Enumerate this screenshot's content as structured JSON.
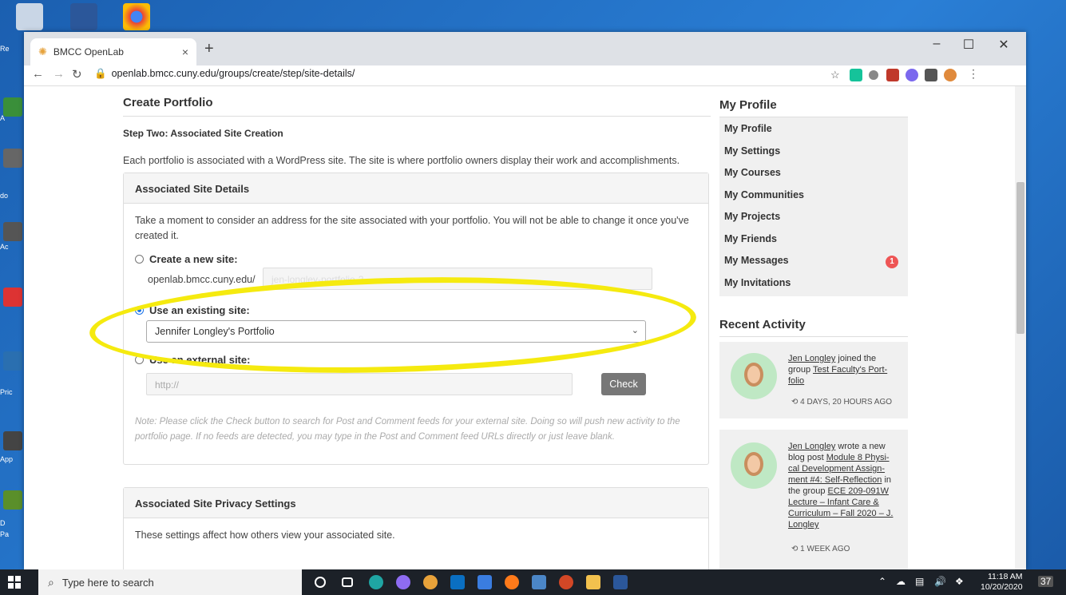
{
  "browser": {
    "tab_title": "BMCC OpenLab",
    "tab_close": "×",
    "new_tab": "+",
    "url": "openlab.bmcc.cuny.edu/groups/create/step/site-details/",
    "controls": {
      "minimize": "–",
      "maximize": "☐",
      "close": "✕"
    }
  },
  "desktop_labels": [
    "Re",
    "A",
    "do",
    "Ac",
    "Pric",
    "App",
    "D",
    "Pa"
  ],
  "page": {
    "title": "Create Portfolio",
    "step": "Step Two: Associated Site Creation",
    "description": "Each portfolio is associated with a WordPress site. The site is where portfolio owners display their work and accomplishments.",
    "details_panel": {
      "heading": "Associated Site Details",
      "intro": "Take a moment to consider an address for the site associated with your portfolio. You will not be able to change it once you've created it.",
      "option_new": "Create a new site:",
      "new_prefix": "openlab.bmcc.cuny.edu/",
      "new_value": "jen-longley-portfolio-2",
      "option_existing": "Use an existing site:",
      "existing_selected": "Jennifer Longley's Portfolio",
      "option_external": "Use an external site:",
      "external_placeholder": "http://",
      "check_button": "Check",
      "note": "Note: Please click the Check button to search for Post and Comment feeds for your external site. Doing so will push new activity to the portfolio page. If no feeds are detected, you may type in the Post and Comment feed URLs directly or just leave blank."
    },
    "privacy_panel": {
      "heading": "Associated Site Privacy Settings",
      "text": "These settings affect how others view your associated site."
    }
  },
  "sidebar": {
    "profile_title": "My Profile",
    "menu": [
      {
        "label": "My Profile"
      },
      {
        "label": "My Settings"
      },
      {
        "label": "My Courses"
      },
      {
        "label": "My Communities"
      },
      {
        "label": "My Projects"
      },
      {
        "label": "My Friends"
      },
      {
        "label": "My Messages",
        "badge": "1"
      },
      {
        "label": "My Invitations"
      }
    ],
    "activity_title": "Recent Activity",
    "activities": [
      {
        "user": "Jen Longley",
        "action": " joined the group ",
        "target": "Test Faculty's Port-folio",
        "time": "4 DAYS, 20 HOURS AGO"
      },
      {
        "user": "Jen Longley",
        "action": " wrote a new blog post ",
        "target": "Module 8 Physi-cal Development Assign-ment #4: Self-Reflection",
        "in_group": " in the group ",
        "group": "ECE 209-091W Lecture – Infant Care & Curriculum – Fall 2020 – J. Longley",
        "time": "1 WEEK AGO"
      }
    ]
  },
  "taskbar": {
    "search_placeholder": "Type here to search",
    "time": "11:18 AM",
    "date": "10/20/2020",
    "notifications": "37"
  },
  "colors": {
    "highlight_ellipse": "#f5ea0f",
    "badge": "#ee5555",
    "radio_selected": "#1a73e8"
  }
}
